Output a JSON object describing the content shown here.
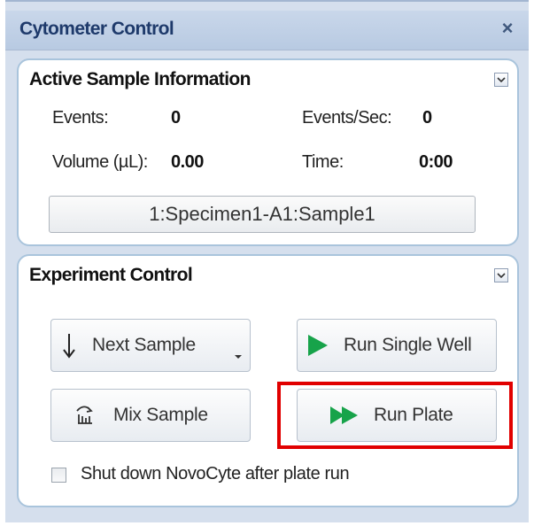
{
  "window": {
    "title": "Cytometer Control",
    "close_glyph": "×"
  },
  "active_sample": {
    "header": "Active Sample Information",
    "events_label": "Events:",
    "events_value": "0",
    "events_per_sec_label": "Events/Sec:",
    "events_per_sec_value": "0",
    "volume_label": "Volume (µL):",
    "volume_value": "0.00",
    "time_label": "Time:",
    "time_value": "0:00",
    "sample_name": "1:Specimen1-A1:Sample1"
  },
  "experiment_control": {
    "header": "Experiment Control",
    "next_sample_label": "Next Sample",
    "run_single_well_label": "Run Single Well",
    "mix_sample_label": "Mix Sample",
    "run_plate_label": "Run Plate",
    "shutdown_label": "Shut down NovoCyte after plate run",
    "shutdown_checked": false
  },
  "icons": {
    "close": "close-icon",
    "collapse": "chevron-down-icon",
    "next_sample": "arrow-down-icon",
    "dropdown": "dropdown-caret-icon",
    "run_single_well": "play-icon",
    "mix_sample": "mix-icon",
    "run_plate": "double-play-icon"
  },
  "colors": {
    "play_green": "#17a34a",
    "highlight_red": "#e10000",
    "title_text": "#1e3a6b",
    "panel_border": "#a9c4dc"
  }
}
